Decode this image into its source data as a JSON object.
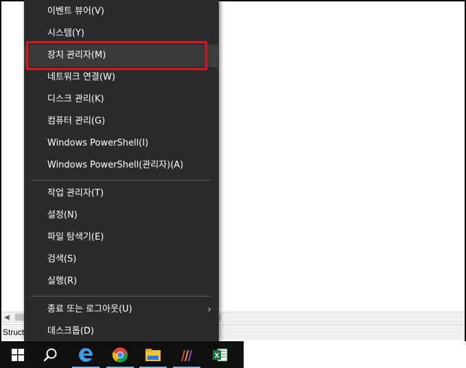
{
  "menu": {
    "items": [
      {
        "label": "이벤트 뷰어(V)"
      },
      {
        "label": "시스템(Y)"
      },
      {
        "label": "장치 관리자(M)"
      },
      {
        "label": "네트워크 연결(W)"
      },
      {
        "label": "디스크 관리(K)"
      },
      {
        "label": "컴퓨터 관리(G)"
      },
      {
        "label": "Windows PowerShell(I)"
      },
      {
        "label": "Windows PowerShell(관리자)(A)"
      },
      {
        "label": "작업 관리자(T)"
      },
      {
        "label": "설정(N)"
      },
      {
        "label": "파일 탐색기(E)"
      },
      {
        "label": "검색(S)"
      },
      {
        "label": "실행(R)"
      },
      {
        "label": "종료 또는 로그아웃(U)"
      },
      {
        "label": "데스크톱(D)"
      }
    ],
    "highlighted_item": "장치 관리자(M)",
    "submenu_chevron": "›"
  },
  "window": {
    "status_text": "Struct"
  },
  "taskbar": {
    "icons": [
      "windows-start-icon",
      "search-icon",
      "edge-icon",
      "chrome-icon",
      "file-explorer-icon",
      "app-icon",
      "excel-icon"
    ]
  },
  "colors": {
    "menu_bg": "#2b2b2b",
    "highlight_border": "#e0141e",
    "taskbar_bg": "#101010"
  }
}
